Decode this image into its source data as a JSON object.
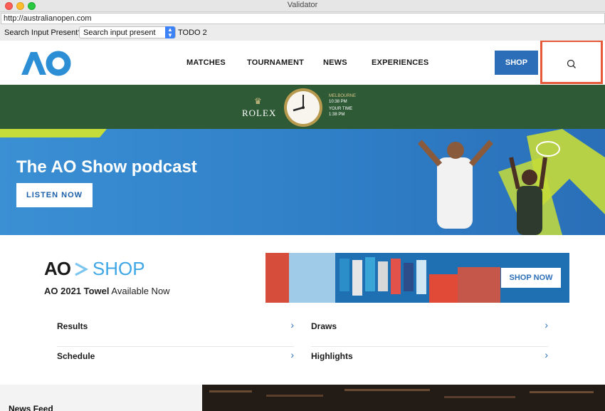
{
  "window": {
    "title": "Validator"
  },
  "urlbar": {
    "url": "http://australianopen.com"
  },
  "toolbar": {
    "label": "Search Input Present?",
    "select_value": "Search input present",
    "todo": "TODO 2"
  },
  "nav": {
    "logo_text": "AO",
    "links": [
      "MATCHES",
      "TOURNAMENT",
      "NEWS",
      "EXPERIENCES"
    ],
    "shop_label": "SHOP"
  },
  "rolex": {
    "brand": "ROLEX",
    "city_label": "MELBOURNE",
    "city_time": "10:38 PM",
    "your_time_label": "YOUR TIME",
    "your_time": "1:38 PM"
  },
  "hero": {
    "title": "The AO Show podcast",
    "button_label": "LISTEN NOW"
  },
  "promo": {
    "logo_ao": "AO",
    "logo_shop": "SHOP",
    "subtitle_bold": "AO 2021 Towel",
    "subtitle_rest": "Available Now",
    "button_label": "SHOP NOW"
  },
  "quick_links": [
    "Results",
    "Draws",
    "Schedule",
    "Highlights"
  ],
  "news_feed": {
    "label": "News Feed"
  },
  "colors": {
    "accent_blue": "#2c6fb8",
    "rolex_green": "#2e5a36",
    "highlight_red": "#e65a3a",
    "hero_chevron": "#c5dc3a"
  }
}
